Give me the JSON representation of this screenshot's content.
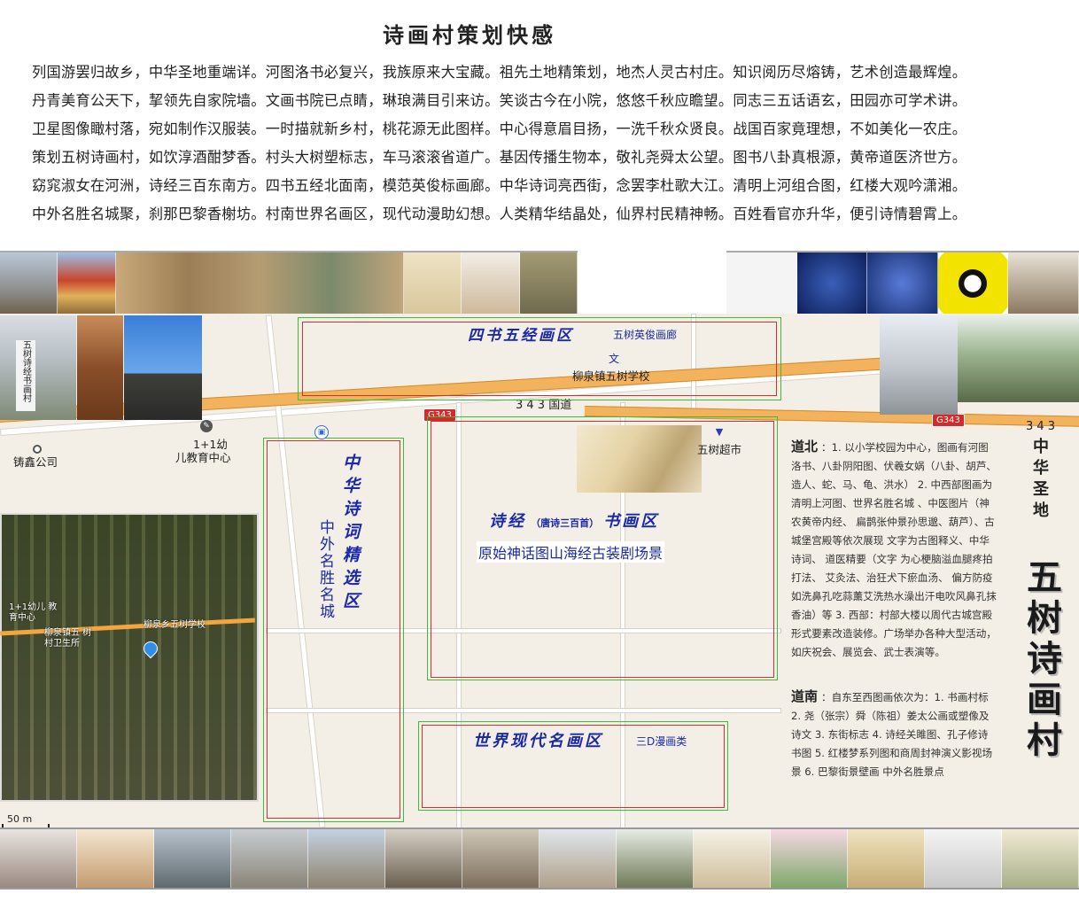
{
  "title": "诗画村策划快感",
  "poem": [
    "列国游罢归故乡，中华圣地重端详。河图洛书必复兴，我族原来大宝藏。祖先土地精策划，地杰人灵古村庄。知识阅历尽熔铸，艺术创造最辉煌。",
    "丹青美育公天下，挈领先自家院墙。文画书院已点睛，琳琅满目引来访。笑谈古今在小院，悠悠千秋应瞻望。同志三五话语玄，田园亦可学术讲。",
    "卫星图像瞰村落，宛如制作汉服装。一时描就新乡村，桃花源无此图样。中心得意眉目扬，一洗千秋众贤良。战国百家竟理想，不如美化一农庄。",
    "策划五树诗画村，如饮淳酒酣梦香。村头大树塑标志，车马滚滚省道广。基因传播生物本，敬礼尧舜太公望。图书八卦真根源，黄帝道医济世方。",
    "窈窕淑女在河洲，诗经三百东南方。四书五经北面南，模范英俊标画廊。中华诗词亮西街，念罢李杜歌大江。清明上河组合图，红楼大观吟潇湘。",
    "中外名胜名城聚，刹那巴黎香榭坊。村南世界名画区，现代动漫助幻想。人类精华结晶处，仙界村民精神畅。百姓看官亦升华，便引诗情碧霄上。"
  ],
  "map": {
    "zones": {
      "north": {
        "title": "四书五经画区",
        "subtitle": "五树英俊画廊"
      },
      "west": {
        "title": "中华诗词精选区",
        "subtitle": "中外名胜名城"
      },
      "center": {
        "title_a": "诗经",
        "title_small": "（唐诗三百首）",
        "title_b": "书画区",
        "subtitle": "原始神话图山海经古装剧场景"
      },
      "south": {
        "title": "世界现代名画区",
        "subtitle": "三D漫画类"
      }
    },
    "labels": {
      "school": "柳泉镇五树学校",
      "national_road": "3 4 3  国道",
      "national_road_right": "3 4 3",
      "g343_a": "G343",
      "g343_b": "G343",
      "company": "铸鑫公司",
      "kindergarten_1": "1+1幼",
      "kindergarten_2": "儿教育中心",
      "supermarket": "五树超市",
      "scale": "50 m"
    },
    "satellite_labels": {
      "kindergarten": "1+1幼儿 教育中心",
      "clinic": "柳泉镇五 树村卫生所",
      "school": "柳泉乡五树学校"
    },
    "poster_small": "中华圣地",
    "poster_big": "五树诗画村",
    "monument_text": "五树诗经书画村",
    "right_text": {
      "north_header": "道北",
      "north_body": "：1. 以小学校园为中心，图画有河图洛书、八卦阴阳图、伏羲女娲（八卦、胡芦、造人、蛇、马、龟、洪水） 2. 中西部图画为清明上河图、世界名胜名城 、中医图片（神农黄帝内经、 扁鹊张仲景孙思邈、葫芦）、古城堡宫殿等依次展现 文字为古图释义、中华诗词、 道医精要（文字 为心梗脑溢血腿疼拍打法、 艾灸法、治狂犬下瘀血汤、 偏方防疫如洗鼻孔吃蒜薰艾洗热水澡出汗电吹风鼻孔抹香油）等 3. 西部：村部大楼以周代古城宫殿形式要素改造装修。广场举办各种大型活动，如庆祝会、展览会、武士表演等。",
      "south_header": "道南",
      "south_body": "：自东至西图画依次为：1. 书画村标 2. 尧（张宗）舜（陈祖）姜太公画或塑像及诗文 3. 东街标志 4. 诗经关雎图、孔子修诗书图 5. 红楼梦系列图和商周封神演义影视场景 6. 巴黎街景壁画 中外名胜景点"
    }
  },
  "colors": {
    "zone_outer": "#35c035",
    "zone_inner": "#d23030",
    "zone_title": "#1a2aa8",
    "road_shield": "#d62a2a",
    "map_bg": "#f4efe6"
  }
}
